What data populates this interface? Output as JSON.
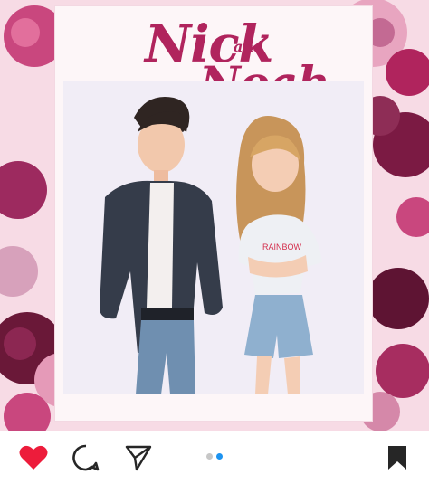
{
  "post": {
    "title_line1": "Nick",
    "title_and": "and",
    "title_line2": "Noah",
    "shirt_text": "RAINBOW"
  },
  "actions": {
    "like_icon": "heart-icon",
    "comment_icon": "speech-bubble-icon",
    "share_icon": "paper-plane-icon",
    "save_icon": "bookmark-icon"
  },
  "carousel": {
    "total": 2,
    "active": 2
  },
  "colors": {
    "like": "#ed1c3b",
    "active_dot": "#1d93f0",
    "inactive_dot": "#c7c7c7",
    "title": "#b0245d",
    "icons": "#262626"
  }
}
